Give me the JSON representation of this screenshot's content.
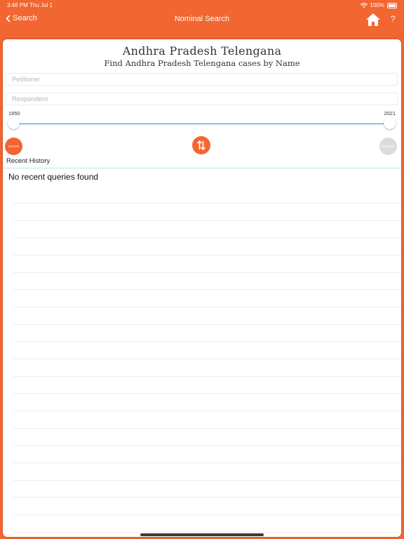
{
  "status_bar": {
    "time": "3:46 PM",
    "date": "Thu Jul 1",
    "battery": "100%"
  },
  "nav": {
    "back_label": "Search",
    "title": "Nominal Search",
    "help": "?"
  },
  "header": {
    "title": "Andhra Pradesh Telengana",
    "subtitle": "Find Andhra Pradesh Telengana cases by Name"
  },
  "form": {
    "petitioner_placeholder": "Petitioner",
    "respondent_placeholder": "Respondent",
    "year_min": "1950",
    "year_max": "2021",
    "clear_label": "CLEAR",
    "search_label": "SEARCH"
  },
  "history": {
    "label": "Recent History",
    "empty_message": "No recent queries found"
  },
  "colors": {
    "accent": "#f16631",
    "slider": "#2f7cf6"
  }
}
